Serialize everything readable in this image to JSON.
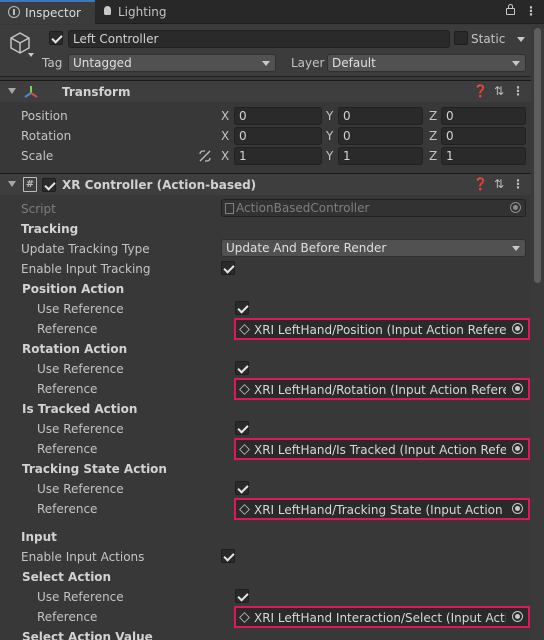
{
  "tabs": {
    "inspector": "Inspector",
    "lighting": "Lighting"
  },
  "object": {
    "name": "Left Controller",
    "static_label": "Static",
    "tag_label": "Tag",
    "tag_value": "Untagged",
    "layer_label": "Layer",
    "layer_value": "Default"
  },
  "transform": {
    "title": "Transform",
    "rows": [
      {
        "label": "Position",
        "x": "0",
        "y": "0",
        "z": "0"
      },
      {
        "label": "Rotation",
        "x": "0",
        "y": "0",
        "z": "0"
      },
      {
        "label": "Scale",
        "x": "1",
        "y": "1",
        "z": "1"
      }
    ],
    "axis": {
      "x": "X",
      "y": "Y",
      "z": "Z"
    }
  },
  "xr": {
    "title": "XR Controller (Action-based)",
    "script_label": "Script",
    "script_value": "ActionBasedController",
    "tracking_header": "Tracking",
    "update_tracking_type_label": "Update Tracking Type",
    "update_tracking_type_value": "Update And Before Render",
    "enable_input_tracking_label": "Enable Input Tracking",
    "actions": [
      {
        "title": "Position Action",
        "use_ref_label": "Use Reference",
        "ref_label": "Reference",
        "ref_value": "XRI LeftHand/Position (Input Action Reference)"
      },
      {
        "title": "Rotation Action",
        "use_ref_label": "Use Reference",
        "ref_label": "Reference",
        "ref_value": "XRI LeftHand/Rotation (Input Action Reference)"
      },
      {
        "title": "Is Tracked Action",
        "use_ref_label": "Use Reference",
        "ref_label": "Reference",
        "ref_value": "XRI LeftHand/Is Tracked (Input Action Reference)"
      },
      {
        "title": "Tracking State Action",
        "use_ref_label": "Use Reference",
        "ref_label": "Reference",
        "ref_value": "XRI LeftHand/Tracking State (Input Action Reference)"
      }
    ],
    "input_header": "Input",
    "enable_input_actions_label": "Enable Input Actions",
    "select_action": {
      "title": "Select Action",
      "use_ref_label": "Use Reference",
      "ref_label": "Reference",
      "ref_value": "XRI LeftHand Interaction/Select (Input Action Reference)"
    },
    "select_action_value_title": "Select Action Value"
  },
  "colors": {
    "highlight": "#e0185a",
    "tab_accent": "#3a79bb"
  }
}
